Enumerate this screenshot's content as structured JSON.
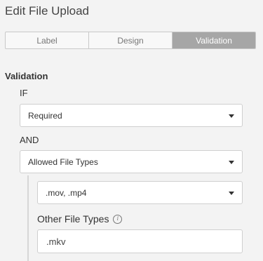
{
  "panel": {
    "title": "Edit File Upload"
  },
  "tabs": [
    {
      "label": "Label",
      "active": false
    },
    {
      "label": "Design",
      "active": false
    },
    {
      "label": "Validation",
      "active": true
    }
  ],
  "validation": {
    "heading": "Validation",
    "if_keyword": "IF",
    "if_select_value": "Required",
    "and_keyword": "AND",
    "and_select_value": "Allowed File Types",
    "file_types_select_value": ".mov, .mp4",
    "other_file_types_label": "Other File Types",
    "other_file_types_value": ".mkv",
    "info_icon_glyph": "i"
  },
  "colors": {
    "active_tab_bg": "#a6a6a6",
    "background": "#f3f3f3"
  }
}
